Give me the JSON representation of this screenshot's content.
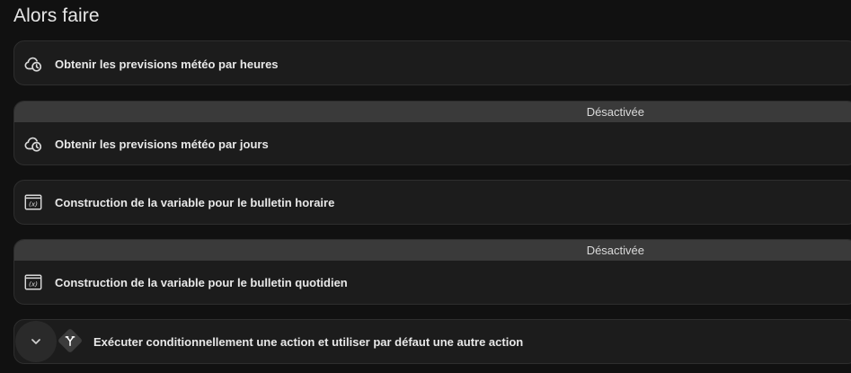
{
  "section": {
    "title": "Alors faire"
  },
  "actions": [
    {
      "label": "Obtenir les previsions météo par heures",
      "icon": "weather-clock-icon",
      "disabled_label": ""
    },
    {
      "label": "Obtenir les previsions météo par jours",
      "icon": "weather-clock-icon",
      "disabled_label": "Désactivée"
    },
    {
      "label": "Construction de la variable pour le bulletin horaire",
      "icon": "variable-icon",
      "disabled_label": ""
    },
    {
      "label": "Construction de la variable pour le bulletin quotidien",
      "icon": "variable-icon",
      "disabled_label": "Désactivée"
    },
    {
      "label": "Exécuter conditionnellement une action et utiliser par défaut une autre action",
      "icon": "branch-icon",
      "disabled_label": ""
    }
  ],
  "colors": {
    "background": "#111111",
    "card": "#1c1c1c",
    "disabled_banner": "#3a3a3a",
    "text": "#e8e8e8"
  }
}
